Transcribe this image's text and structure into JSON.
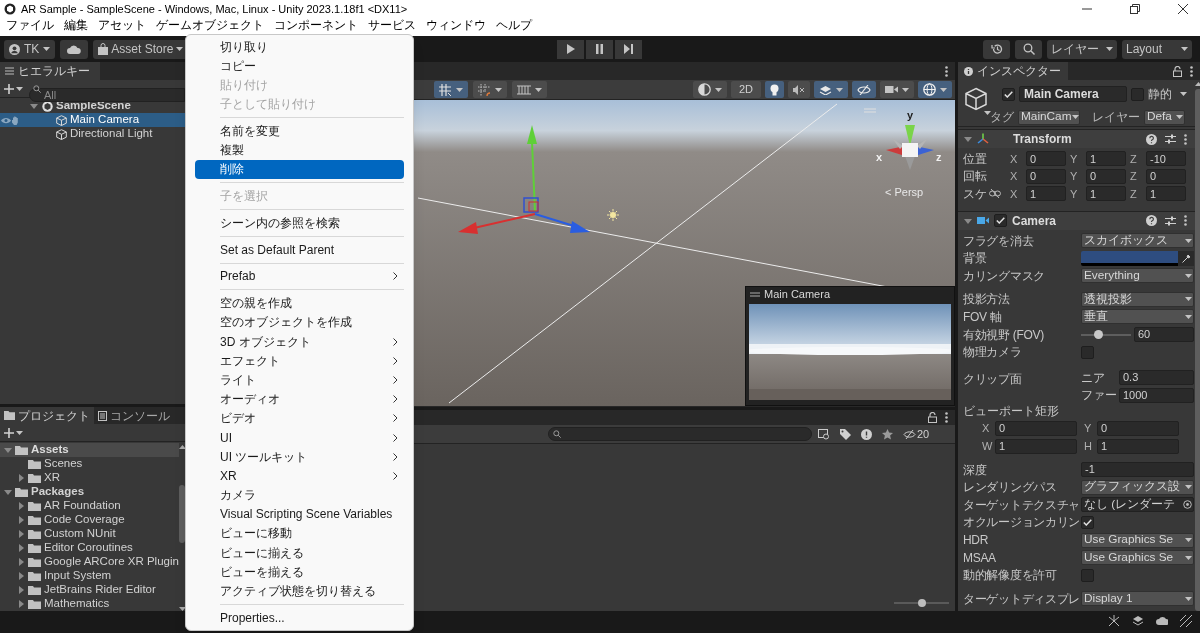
{
  "window": {
    "title": "AR Sample - SampleScene - Windows, Mac, Linux - Unity 2023.1.18f1 <DX11>"
  },
  "menu_bar": [
    "ファイル",
    "編集",
    "アセット",
    "ゲームオブジェクト",
    "コンポーネント",
    "サービス",
    "ウィンドウ",
    "ヘルプ"
  ],
  "toolbar": {
    "account": "TK",
    "asset_store": "Asset Store",
    "layers": "レイヤー",
    "layout": "Layout"
  },
  "hierarchy": {
    "tab": "ヒエラルキー",
    "search": {
      "placeholder": "All"
    },
    "tree": [
      {
        "label": "SampleScene",
        "kind": "scene",
        "selected": false,
        "expanded": true,
        "children": [
          {
            "label": "Main Camera",
            "kind": "object",
            "selected": true
          },
          {
            "label": "Directional Light",
            "kind": "object",
            "selected": false
          }
        ]
      }
    ]
  },
  "context_menu": [
    {
      "kind": "item",
      "label": "切り取り",
      "disabled": false,
      "selected": false,
      "submenu": false
    },
    {
      "kind": "item",
      "label": "コピー",
      "disabled": false,
      "selected": false,
      "submenu": false
    },
    {
      "kind": "item",
      "label": "貼り付け",
      "disabled": true,
      "selected": false,
      "submenu": false
    },
    {
      "kind": "item",
      "label": "子として貼り付け",
      "disabled": true,
      "selected": false,
      "submenu": false
    },
    {
      "kind": "separator"
    },
    {
      "kind": "item",
      "label": "名前を変更",
      "disabled": false,
      "selected": false,
      "submenu": false
    },
    {
      "kind": "item",
      "label": "複製",
      "disabled": false,
      "selected": false,
      "submenu": false
    },
    {
      "kind": "item",
      "label": "削除",
      "disabled": false,
      "selected": true,
      "submenu": false
    },
    {
      "kind": "separator"
    },
    {
      "kind": "item",
      "label": "子を選択",
      "disabled": true,
      "selected": false,
      "submenu": false
    },
    {
      "kind": "separator"
    },
    {
      "kind": "item",
      "label": "シーン内の参照を検索",
      "disabled": false,
      "selected": false,
      "submenu": false
    },
    {
      "kind": "separator"
    },
    {
      "kind": "item",
      "label": "Set as Default Parent",
      "disabled": false,
      "selected": false,
      "submenu": false
    },
    {
      "kind": "separator"
    },
    {
      "kind": "item",
      "label": "Prefab",
      "disabled": false,
      "selected": false,
      "submenu": true
    },
    {
      "kind": "separator"
    },
    {
      "kind": "item",
      "label": "空の親を作成",
      "disabled": false,
      "selected": false,
      "submenu": false
    },
    {
      "kind": "item",
      "label": "空のオブジェクトを作成",
      "disabled": false,
      "selected": false,
      "submenu": false
    },
    {
      "kind": "item",
      "label": "3D オブジェクト",
      "disabled": false,
      "selected": false,
      "submenu": true
    },
    {
      "kind": "item",
      "label": "エフェクト",
      "disabled": false,
      "selected": false,
      "submenu": true
    },
    {
      "kind": "item",
      "label": "ライト",
      "disabled": false,
      "selected": false,
      "submenu": true
    },
    {
      "kind": "item",
      "label": "オーディオ",
      "disabled": false,
      "selected": false,
      "submenu": true
    },
    {
      "kind": "item",
      "label": "ビデオ",
      "disabled": false,
      "selected": false,
      "submenu": true
    },
    {
      "kind": "item",
      "label": "UI",
      "disabled": false,
      "selected": false,
      "submenu": true
    },
    {
      "kind": "item",
      "label": "UI ツールキット",
      "disabled": false,
      "selected": false,
      "submenu": true
    },
    {
      "kind": "item",
      "label": "XR",
      "disabled": false,
      "selected": false,
      "submenu": true
    },
    {
      "kind": "item",
      "label": "カメラ",
      "disabled": false,
      "selected": false,
      "submenu": false
    },
    {
      "kind": "item",
      "label": "Visual Scripting Scene Variables",
      "disabled": false,
      "selected": false,
      "submenu": false
    },
    {
      "kind": "item",
      "label": "ビューに移動",
      "disabled": false,
      "selected": false,
      "submenu": false
    },
    {
      "kind": "item",
      "label": "ビューに揃える",
      "disabled": false,
      "selected": false,
      "submenu": false
    },
    {
      "kind": "item",
      "label": "ビューを揃える",
      "disabled": false,
      "selected": false,
      "submenu": false
    },
    {
      "kind": "item",
      "label": "アクティブ状態を切り替える",
      "disabled": false,
      "selected": false,
      "submenu": false
    },
    {
      "kind": "separator"
    },
    {
      "kind": "item",
      "label": "Properties...",
      "disabled": false,
      "selected": false,
      "submenu": false
    }
  ],
  "scene_view": {
    "toolbar_left": [
      {
        "kind": "grid_snap",
        "on": true,
        "dropdown": true
      },
      {
        "kind": "increment_snap",
        "on": false,
        "dropdown": true
      },
      {
        "kind": "grid",
        "on": false,
        "dropdown": true
      }
    ],
    "toolbar_right": [
      {
        "kind": "shading",
        "on": false,
        "dropdown": true
      },
      {
        "kind": "mode_2d",
        "label": "2D",
        "on": false,
        "dropdown": false
      },
      {
        "kind": "lighting",
        "on": true,
        "dropdown": false
      },
      {
        "kind": "audio",
        "on": false,
        "dropdown": false
      },
      {
        "kind": "effects",
        "on": true,
        "dropdown": true
      },
      {
        "kind": "visibility",
        "on": true,
        "dropdown": false
      },
      {
        "kind": "camera",
        "on": false,
        "dropdown": true
      },
      {
        "kind": "gizmos",
        "on": true,
        "dropdown": true
      }
    ],
    "axes": [
      "y",
      "x",
      "z"
    ],
    "persp_label": "< Persp",
    "camera_preview": {
      "title": "Main Camera"
    }
  },
  "project": {
    "tabs": [
      {
        "label": "プロジェクト",
        "selected": true
      },
      {
        "label": "コンソール",
        "selected": false
      }
    ],
    "tree": [
      {
        "label": "Assets",
        "selected": true,
        "expanded": true,
        "children": [
          {
            "label": "Scenes",
            "selected": false
          },
          {
            "label": "XR",
            "selected": false,
            "expanded": false
          }
        ]
      },
      {
        "label": "Packages",
        "selected": false,
        "expanded": true,
        "children": [
          {
            "label": "AR Foundation",
            "selected": false,
            "expanded": false
          },
          {
            "label": "Code Coverage",
            "selected": false,
            "expanded": false
          },
          {
            "label": "Custom NUnit",
            "selected": false,
            "expanded": false
          },
          {
            "label": "Editor Coroutines",
            "selected": false,
            "expanded": false
          },
          {
            "label": "Google ARCore XR Plugin",
            "selected": false,
            "expanded": false
          },
          {
            "label": "Input System",
            "selected": false,
            "expanded": false
          },
          {
            "label": "JetBrains Rider Editor",
            "selected": false,
            "expanded": false
          },
          {
            "label": "Mathematics",
            "selected": false,
            "expanded": false
          }
        ]
      }
    ]
  },
  "bottom_panel": {
    "hidden_count": "20",
    "zoom_slider": {
      "level": 0.5
    }
  },
  "inspector": {
    "tab": "インスペクター",
    "object": {
      "active": true,
      "name": "Main Camera",
      "static": false,
      "static_label": "静的",
      "tag_label": "タグ",
      "tag": "MainCam",
      "layer_label": "レイヤー",
      "layer": "Defa"
    },
    "components": [
      {
        "kind": "transform",
        "name": "Transform",
        "expanded": true,
        "rows": [
          {
            "kind": "vec",
            "label": "位置",
            "fields": [
              {
                "axis": "X",
                "value": "0"
              },
              {
                "axis": "Y",
                "value": "1"
              },
              {
                "axis": "Z",
                "value": "-10"
              }
            ]
          },
          {
            "kind": "vec",
            "label": "回転",
            "fields": [
              {
                "axis": "X",
                "value": "0"
              },
              {
                "axis": "Y",
                "value": "0"
              },
              {
                "axis": "Z",
                "value": "0"
              }
            ]
          },
          {
            "kind": "vec",
            "label": "スケ",
            "linked": false,
            "fields": [
              {
                "axis": "X",
                "value": "1"
              },
              {
                "axis": "Y",
                "value": "1"
              },
              {
                "axis": "Z",
                "value": "1"
              }
            ]
          }
        ]
      },
      {
        "kind": "camera",
        "name": "Camera",
        "enabled": true,
        "expanded": true,
        "rows": [
          {
            "kind": "dropdown",
            "label": "フラグを消去",
            "value": "スカイボックス"
          },
          {
            "kind": "color",
            "label": "背景",
            "color": "#2e4d80"
          },
          {
            "kind": "dropdown",
            "label": "カリングマスク",
            "value": "Everything"
          },
          {
            "kind": "dropdown",
            "label": "投影方法",
            "value": "透視投影",
            "gap_before": true
          },
          {
            "kind": "dropdown",
            "label": "FOV 軸",
            "value": "垂直"
          },
          {
            "kind": "slider",
            "label": "有効視野 (FOV)",
            "level": 0.35,
            "value": "60"
          },
          {
            "kind": "checkbox",
            "label": "物理カメラ",
            "checked": false
          },
          {
            "kind": "stack",
            "label": "クリップ面",
            "gap_before": true,
            "fields": [
              {
                "label": "ニア",
                "value": "0.3"
              },
              {
                "label": "ファー",
                "value": "1000"
              }
            ]
          },
          {
            "kind": "heading",
            "label": "ビューポート矩形"
          },
          {
            "kind": "pair",
            "fields": [
              {
                "axis": "X",
                "value": "0"
              },
              {
                "axis": "Y",
                "value": "0"
              }
            ]
          },
          {
            "kind": "pair",
            "fields": [
              {
                "axis": "W",
                "value": "1"
              },
              {
                "axis": "H",
                "value": "1"
              }
            ]
          },
          {
            "kind": "number",
            "label": "深度",
            "value": "-1",
            "gap_before": true
          },
          {
            "kind": "dropdown",
            "label": "レンダリングパス",
            "value": "グラフィックス設"
          },
          {
            "kind": "object",
            "label": "ターゲットテクスチャ",
            "value": "なし (レンダーテ"
          },
          {
            "kind": "checkbox",
            "label": "オクルージョンカリン",
            "checked": true
          },
          {
            "kind": "dropdown",
            "label": "HDR",
            "value": "Use Graphics Se"
          },
          {
            "kind": "dropdown",
            "label": "MSAA",
            "value": "Use Graphics Se"
          },
          {
            "kind": "checkbox",
            "label": "動的解像度を許可",
            "checked": false
          },
          {
            "kind": "dropdown",
            "label": "ターゲットディスプレ",
            "value": "Display 1",
            "gap_before": true
          }
        ]
      }
    ]
  }
}
